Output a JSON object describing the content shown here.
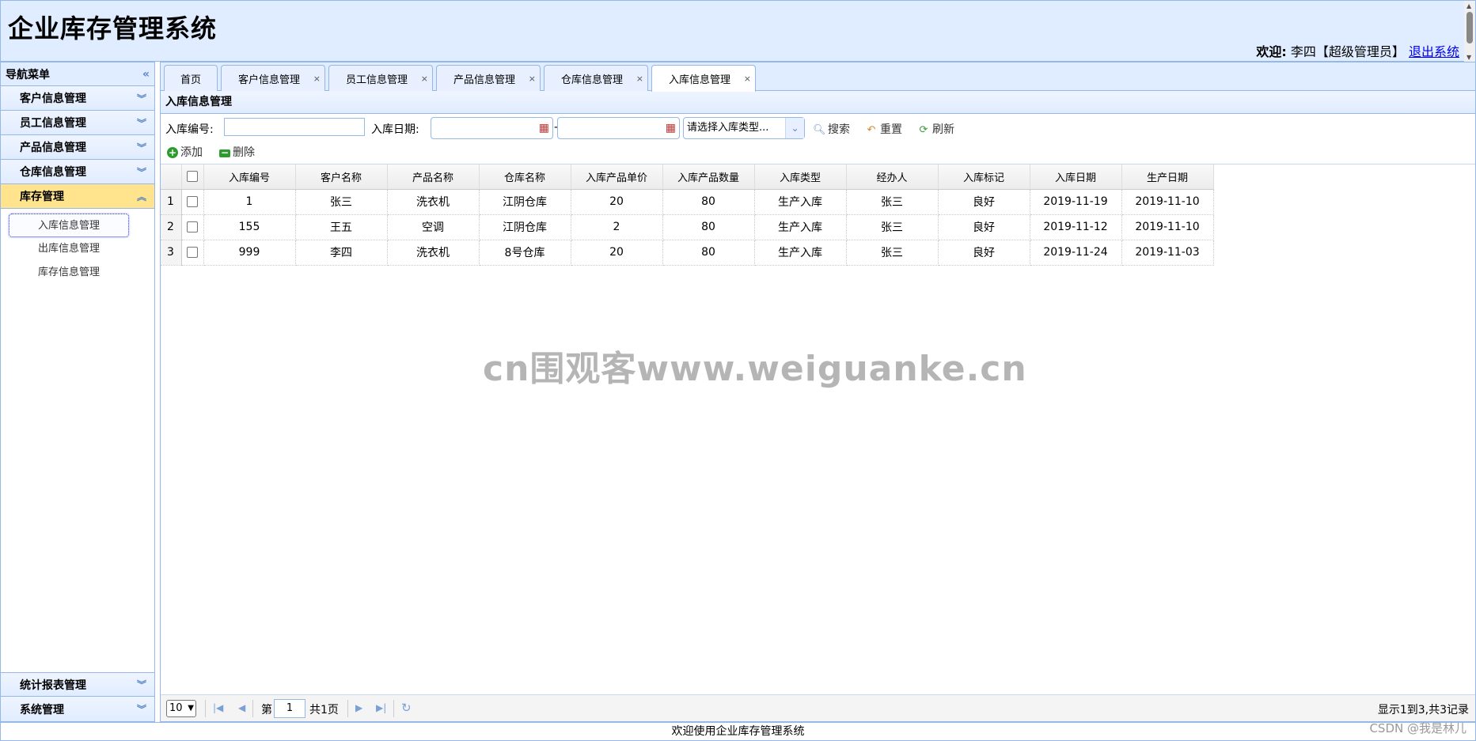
{
  "header": {
    "title": "企业库存管理系统",
    "welcome_label": "欢迎:",
    "user": "李四【超级管理员】",
    "logout": "退出系统"
  },
  "sidebar": {
    "title": "导航菜单",
    "sections_top": [
      {
        "label": "客户信息管理"
      },
      {
        "label": "员工信息管理"
      },
      {
        "label": "产品信息管理"
      },
      {
        "label": "仓库信息管理"
      },
      {
        "label": "库存管理"
      }
    ],
    "sub_items": [
      {
        "label": "入库信息管理"
      },
      {
        "label": "出库信息管理"
      },
      {
        "label": "库存信息管理"
      }
    ],
    "sections_bottom": [
      {
        "label": "统计报表管理"
      },
      {
        "label": "系统管理"
      }
    ]
  },
  "tabs": [
    {
      "label": "首页"
    },
    {
      "label": "客户信息管理"
    },
    {
      "label": "员工信息管理"
    },
    {
      "label": "产品信息管理"
    },
    {
      "label": "仓库信息管理"
    },
    {
      "label": "入库信息管理"
    }
  ],
  "panel": {
    "title": "入库信息管理"
  },
  "search": {
    "id_label": "入库编号:",
    "id_value": "",
    "date_label": "入库日期:",
    "date_sep": "-",
    "type_placeholder": "请选择入库类型...",
    "search": "搜索",
    "reset": "重置",
    "refresh": "刷新",
    "add": "添加",
    "delete": "删除"
  },
  "grid": {
    "columns": [
      "入库编号",
      "客户名称",
      "产品名称",
      "仓库名称",
      "入库产品单价",
      "入库产品数量",
      "入库类型",
      "经办人",
      "入库标记",
      "入库日期",
      "生产日期"
    ],
    "rows": [
      {
        "rn": "1",
        "cells": [
          "1",
          "张三",
          "洗衣机",
          "江阴仓库",
          "20",
          "80",
          "生产入库",
          "张三",
          "良好",
          "2019-11-19",
          "2019-11-10"
        ]
      },
      {
        "rn": "2",
        "cells": [
          "155",
          "王五",
          "空调",
          "江阴仓库",
          "2",
          "80",
          "生产入库",
          "张三",
          "良好",
          "2019-11-12",
          "2019-11-10"
        ]
      },
      {
        "rn": "3",
        "cells": [
          "999",
          "李四",
          "洗衣机",
          "8号仓库",
          "20",
          "80",
          "生产入库",
          "张三",
          "良好",
          "2019-11-24",
          "2019-11-03"
        ]
      }
    ]
  },
  "pager": {
    "page_size": "10",
    "page_prefix": "第",
    "page_num": "1",
    "page_total": "共1页",
    "summary": "显示1到3,共3记录"
  },
  "footer": {
    "text": "欢迎使用企业库存管理系统"
  },
  "watermark": {
    "text": "cn围观客www.weiguanke.cn",
    "csdn": "CSDN @我是林儿"
  }
}
